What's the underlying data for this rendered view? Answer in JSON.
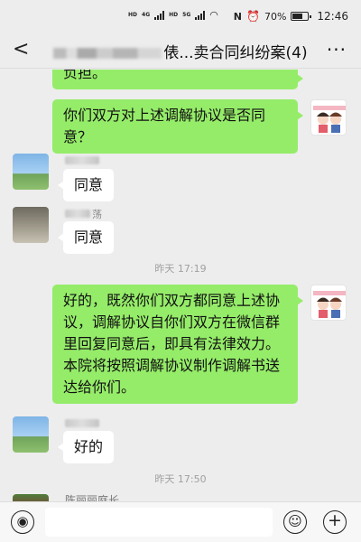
{
  "status_bar": {
    "net1": "HD",
    "net2": "HD",
    "gen1": "4G",
    "gen2": "5G",
    "battery_percent": "70%",
    "battery_level": 0.7,
    "time": "12:46"
  },
  "header": {
    "title_visible": "俵...卖合同纠纷案(4)",
    "more_label": "···",
    "back_label": "<"
  },
  "messages": {
    "m0": "负担。",
    "m1": "你们双方对上述调解协议是否同意？",
    "m2": "同意",
    "m3": "同意",
    "m4": "好的，既然你们双方都同意上述协议，调解协议自你们双方在微信群里回复同意后，即具有法律效力。本院将按照调解协议制作调解书送达给你们。",
    "m5": "好的",
    "nick_partial": "荡",
    "last_nick": "陈丽丽庭长"
  },
  "timestamps": {
    "t1": "昨天 17:19",
    "t2": "昨天 17:50"
  },
  "input": {
    "voice_icon": "voice-icon",
    "emoji_icon": "emoji-icon",
    "plus_icon": "plus-icon"
  }
}
